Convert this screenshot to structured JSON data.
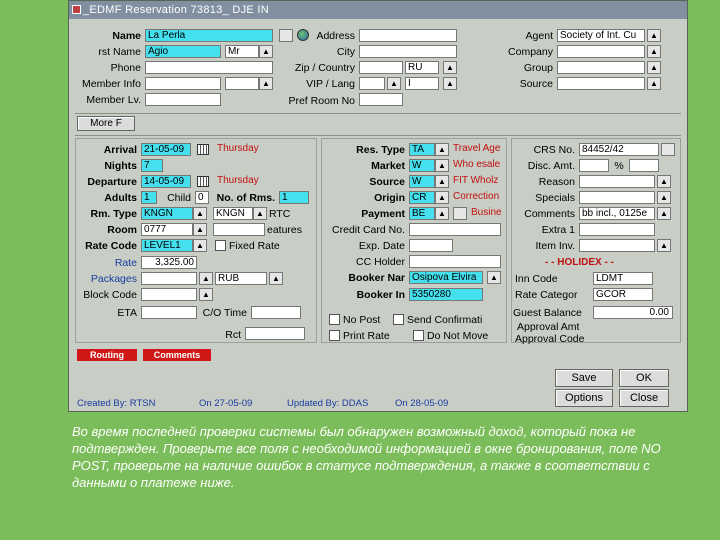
{
  "window": {
    "title": "_EDMF  Reservation 73813_ DJE IN"
  },
  "guest": {
    "name_label": "Name",
    "name_value": "La Perla",
    "first_name_label": "rst Name",
    "first_name_value": "Agio",
    "title_value": "Mr",
    "phone_label": "Phone",
    "member_info_label": "Member Info",
    "member_lv_label": "Member Lv.",
    "address_label": "Address",
    "city_label": "City",
    "zip_country_label": "Zip / Country",
    "country_value": "RU",
    "vip_lang_label": "VIP / Lang",
    "lang_value": "I",
    "pref_room_label": "Pref Room No",
    "agent_label": "Agent",
    "agent_value": "Society of Int. Cu",
    "company_label": "Company",
    "group_label": "Group",
    "source_label": "Source"
  },
  "more_button": "More F",
  "stay": {
    "arrival_label": "Arrival",
    "arrival_value": "21-05-09",
    "arrival_day": "Thursday",
    "nights_label": "Nights",
    "nights_value": "7",
    "departure_label": "Departure",
    "departure_value": "14-05-09",
    "departure_day": "Thursday",
    "adults_label": "Adults",
    "adults_value": "1",
    "child_label": "Child",
    "child_value": "0",
    "no_rms_label": "No. of Rms.",
    "no_rms_value": "1",
    "rm_type_label": "Rm. Type",
    "rm_type_value": "KNGN",
    "rm_type_value2": "KNGN",
    "rtc_label": "RTC",
    "room_label": "Room",
    "room_value": "0777",
    "features_label": "eatures",
    "rate_code_label": "Rate Code",
    "rate_code_value": "LEVEL1",
    "fixed_rate_label": "Fixed Rate",
    "rate_label": "Rate",
    "rate_value": "3,325.00",
    "packages_label": "Packages",
    "currency_value": "RUB",
    "block_code_label": "Block Code",
    "eta_label": "ETA",
    "cio_time_label": "C/O Time",
    "rct_label": "Rct"
  },
  "reservation": {
    "res_type_label": "Res. Type",
    "res_type_value": "TA",
    "res_type_desc": "Travel Age",
    "market_label": "Market",
    "market_value": "W",
    "market_desc": "Who esale",
    "source_label": "Source",
    "source_value": "W",
    "source_desc": "FIT Wholz",
    "origin_label": "Origin",
    "origin_value": "CR",
    "origin_desc": "Correction",
    "payment_label": "Payment",
    "payment_value": "BE",
    "payment_desc": "Busine",
    "credit_card_label": "Credit Card No.",
    "exp_date_label": "Exp. Date",
    "cc_holder_label": "CC Holder",
    "booker_name_label": "Booker Nar",
    "booker_name_value": "Osipova Elvira",
    "booker_info_label": "Booker In",
    "booker_info_value": "5350280",
    "no_post_label": "No Post",
    "print_rate_label": "Print Rate",
    "send_confirm_label": "Send Confirmati",
    "do_not_move_label": "Do Not Move"
  },
  "right": {
    "crs_label": "CRS No.",
    "crs_value": "84452/42",
    "disc_label": "Disc. Amt.",
    "disc_pct": "%",
    "reason_label": "Reason",
    "specials_label": "Specials",
    "comments_label": "Comments",
    "comments_value": "bb incl., 0125e",
    "extra1_label": "Extra 1",
    "item_inv_label": "Item Inv.",
    "holidex_header": "- - HOLIDEX - -",
    "inn_code_label": "Inn Code",
    "inn_code_value": "LDMT",
    "rate_category_label": "Rate Categor",
    "rate_category_value": "GCOR",
    "guest_balance_label": "Guest Balance",
    "guest_balance_value": "0.00",
    "approval_amt_label": "Approval Amt",
    "approval_code_label": "Approval Code"
  },
  "tabs": {
    "routing": "Routing",
    "comments": "Comments"
  },
  "buttons": {
    "save": "Save",
    "ok": "OK",
    "options": "Options",
    "close": "Close"
  },
  "status": {
    "created_by": "Created By: RTSN",
    "created_on": "On 27-05-09",
    "updated_by": "Updated By: DDAS",
    "updated_on": "On 28-05-09"
  },
  "footer_text": "Во время последней проверки системы был обнаружен возможный доход, который пока не подтвержден. Проверьте все поля с необходимой информацией в окне бронирования, поле NO POST, проверьте на наличие ошибок в статусе подтверждения, а также в соответствии с данными о платеже ниже."
}
